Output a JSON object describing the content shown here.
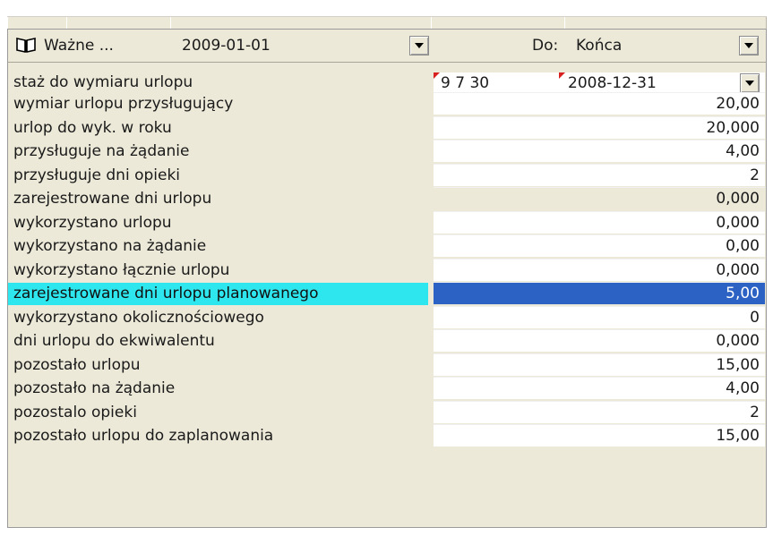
{
  "header": {
    "valid_label": "Ważne ...",
    "valid_date": "2009-01-01",
    "to_label": "Do:",
    "to_value": "Końca"
  },
  "first_row": {
    "label": "staż do wymiaru urlopu",
    "value_years_months_days": "9  7  30",
    "value_date": "2008-12-31"
  },
  "rows": [
    {
      "label": "wymiar urlopu przysługujący",
      "value": "20,00"
    },
    {
      "label": "urlop do wyk. w roku",
      "value": "20,000"
    },
    {
      "label": "przysługuje na żądanie",
      "value": "4,00"
    },
    {
      "label": "przysługuje dni opieki",
      "value": "2"
    },
    {
      "label": "zarejestrowane dni urlopu",
      "value": "0,000"
    },
    {
      "label": "wykorzystano urlopu",
      "value": "0,000"
    },
    {
      "label": "wykorzystano na żądanie",
      "value": "0,00"
    },
    {
      "label": "wykorzystano łącznie urlopu",
      "value": "0,000"
    },
    {
      "label": "zarejestrowane dni urlopu planowanego",
      "value": "5,00"
    },
    {
      "label": "wykorzystano okolicznościowego",
      "value": "0"
    },
    {
      "label": "dni urlopu do ekwiwalentu",
      "value": "0,000"
    },
    {
      "label": "pozostało urlopu",
      "value": "15,00"
    },
    {
      "label": "pozostało na żądanie",
      "value": "4,00"
    },
    {
      "label": "pozostalo opieki",
      "value": "2"
    },
    {
      "label": "pozostało urlopu do zaplanowania",
      "value": "15,00"
    }
  ]
}
